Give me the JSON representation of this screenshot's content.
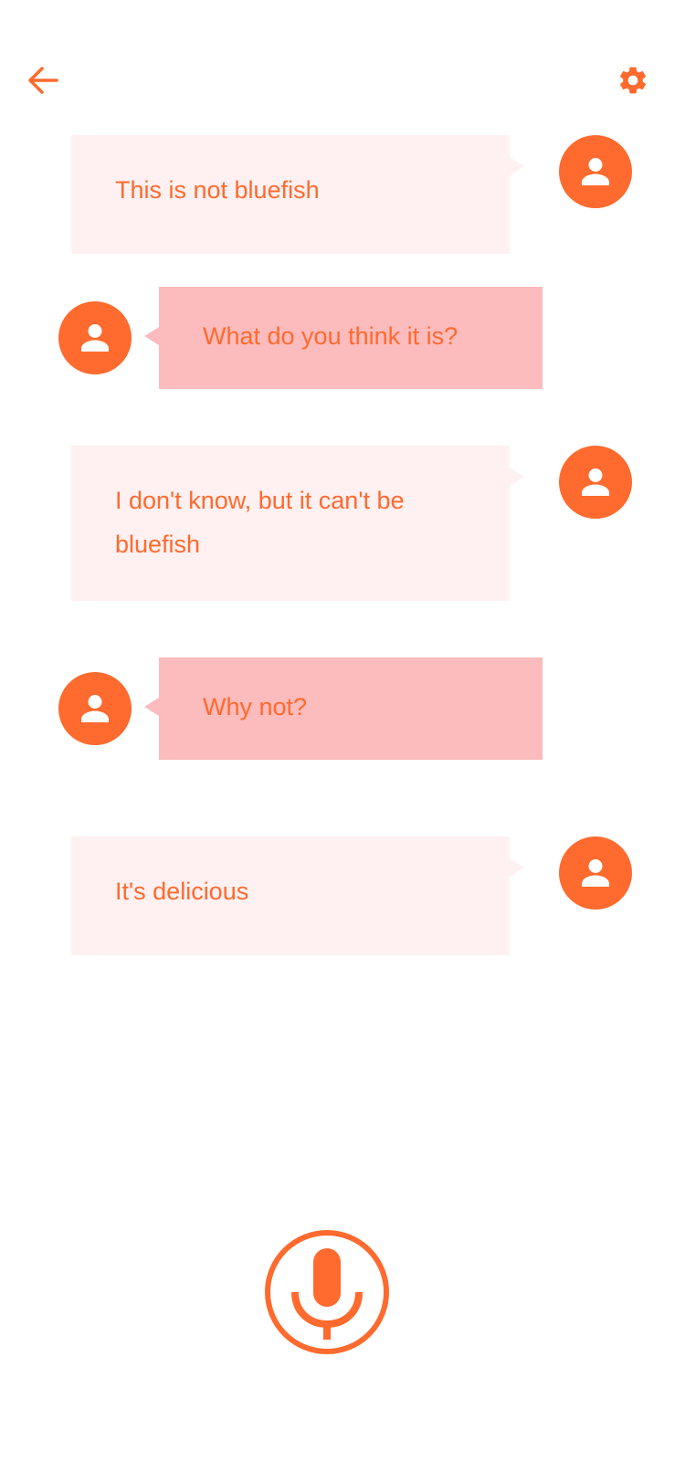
{
  "colors": {
    "accent": "#ff6a2e",
    "bubble_mine": "#fff0f1",
    "bubble_theirs": "#fcbbbc",
    "background": "#ffffff"
  },
  "toolbar": {
    "back_icon": "arrow-left-icon",
    "settings_icon": "gear-icon"
  },
  "messages": [
    {
      "sender": "me",
      "text": "This is not bluefish"
    },
    {
      "sender": "other",
      "text": "What do you think it is?"
    },
    {
      "sender": "me",
      "text": "I don't know, but it can't be bluefish"
    },
    {
      "sender": "other",
      "text": "Why not?"
    },
    {
      "sender": "me",
      "text": "It's delicious"
    }
  ],
  "mic": {
    "icon": "microphone-icon"
  }
}
